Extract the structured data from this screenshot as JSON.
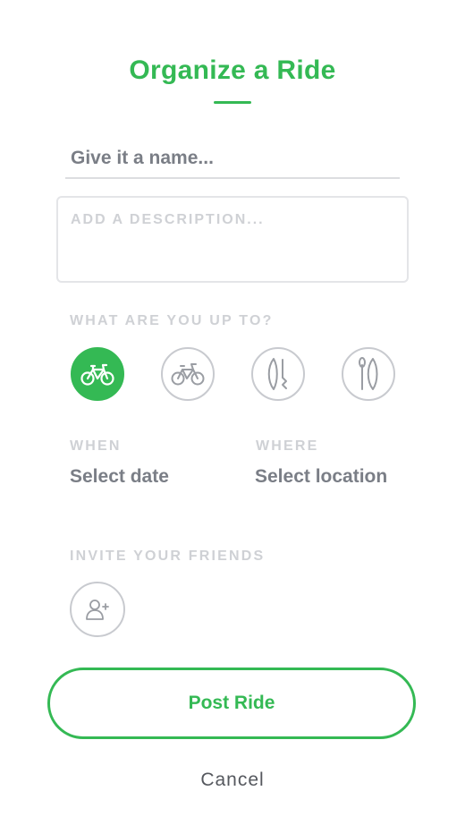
{
  "title": "Organize a Ride",
  "form": {
    "name_placeholder": "Give it a name...",
    "name_value": "",
    "description_placeholder": "ADD A DESCRIPTION...",
    "description_value": ""
  },
  "activity": {
    "label": "WHAT ARE YOU UP TO?",
    "options": [
      {
        "icon": "road-bike-icon",
        "selected": true
      },
      {
        "icon": "mountain-bike-icon",
        "selected": false
      },
      {
        "icon": "surfboard-icon",
        "selected": false
      },
      {
        "icon": "paddleboard-icon",
        "selected": false
      }
    ]
  },
  "when": {
    "label": "WHEN",
    "value": "Select date"
  },
  "where": {
    "label": "WHERE",
    "value": "Select location"
  },
  "invite": {
    "label": "INVITE YOUR FRIENDS",
    "icon": "add-person-icon"
  },
  "post_label": "Post Ride",
  "cancel_label": "Cancel",
  "colors": {
    "accent": "#34b954",
    "muted": "#cfd1d5",
    "text": "#7a7e86"
  }
}
